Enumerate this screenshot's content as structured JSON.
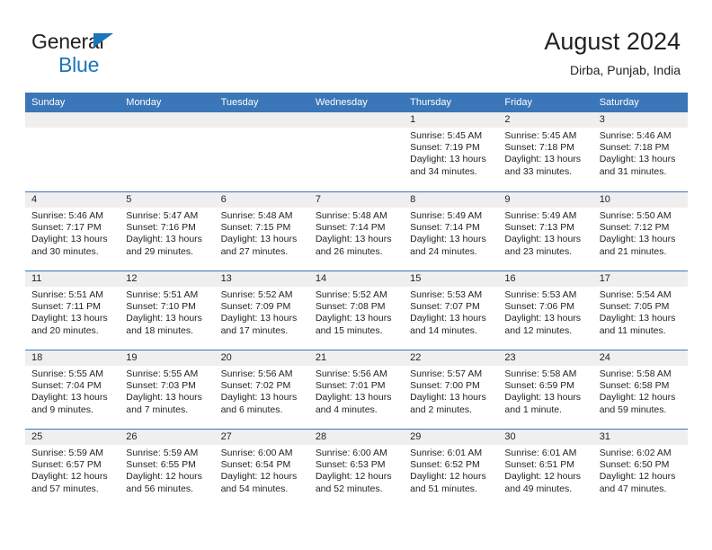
{
  "brand": {
    "line1": "General",
    "line2": "Blue",
    "flag_color": "#1b75bb"
  },
  "header": {
    "title": "August 2024",
    "subtitle": "Dirba, Punjab, India"
  },
  "theme": {
    "header_blue": "#3a76b8",
    "day_band_gray": "#efefef",
    "text_color": "#231f20"
  },
  "calendar": {
    "weekdays": [
      "Sunday",
      "Monday",
      "Tuesday",
      "Wednesday",
      "Thursday",
      "Friday",
      "Saturday"
    ],
    "weeks": [
      [
        {
          "day": "",
          "empty": true
        },
        {
          "day": "",
          "empty": true
        },
        {
          "day": "",
          "empty": true
        },
        {
          "day": "",
          "empty": true
        },
        {
          "day": "1",
          "sunrise": "Sunrise: 5:45 AM",
          "sunset": "Sunset: 7:19 PM",
          "daylight": "Daylight: 13 hours and 34 minutes."
        },
        {
          "day": "2",
          "sunrise": "Sunrise: 5:45 AM",
          "sunset": "Sunset: 7:18 PM",
          "daylight": "Daylight: 13 hours and 33 minutes."
        },
        {
          "day": "3",
          "sunrise": "Sunrise: 5:46 AM",
          "sunset": "Sunset: 7:18 PM",
          "daylight": "Daylight: 13 hours and 31 minutes."
        }
      ],
      [
        {
          "day": "4",
          "sunrise": "Sunrise: 5:46 AM",
          "sunset": "Sunset: 7:17 PM",
          "daylight": "Daylight: 13 hours and 30 minutes."
        },
        {
          "day": "5",
          "sunrise": "Sunrise: 5:47 AM",
          "sunset": "Sunset: 7:16 PM",
          "daylight": "Daylight: 13 hours and 29 minutes."
        },
        {
          "day": "6",
          "sunrise": "Sunrise: 5:48 AM",
          "sunset": "Sunset: 7:15 PM",
          "daylight": "Daylight: 13 hours and 27 minutes."
        },
        {
          "day": "7",
          "sunrise": "Sunrise: 5:48 AM",
          "sunset": "Sunset: 7:14 PM",
          "daylight": "Daylight: 13 hours and 26 minutes."
        },
        {
          "day": "8",
          "sunrise": "Sunrise: 5:49 AM",
          "sunset": "Sunset: 7:14 PM",
          "daylight": "Daylight: 13 hours and 24 minutes."
        },
        {
          "day": "9",
          "sunrise": "Sunrise: 5:49 AM",
          "sunset": "Sunset: 7:13 PM",
          "daylight": "Daylight: 13 hours and 23 minutes."
        },
        {
          "day": "10",
          "sunrise": "Sunrise: 5:50 AM",
          "sunset": "Sunset: 7:12 PM",
          "daylight": "Daylight: 13 hours and 21 minutes."
        }
      ],
      [
        {
          "day": "11",
          "sunrise": "Sunrise: 5:51 AM",
          "sunset": "Sunset: 7:11 PM",
          "daylight": "Daylight: 13 hours and 20 minutes."
        },
        {
          "day": "12",
          "sunrise": "Sunrise: 5:51 AM",
          "sunset": "Sunset: 7:10 PM",
          "daylight": "Daylight: 13 hours and 18 minutes."
        },
        {
          "day": "13",
          "sunrise": "Sunrise: 5:52 AM",
          "sunset": "Sunset: 7:09 PM",
          "daylight": "Daylight: 13 hours and 17 minutes."
        },
        {
          "day": "14",
          "sunrise": "Sunrise: 5:52 AM",
          "sunset": "Sunset: 7:08 PM",
          "daylight": "Daylight: 13 hours and 15 minutes."
        },
        {
          "day": "15",
          "sunrise": "Sunrise: 5:53 AM",
          "sunset": "Sunset: 7:07 PM",
          "daylight": "Daylight: 13 hours and 14 minutes."
        },
        {
          "day": "16",
          "sunrise": "Sunrise: 5:53 AM",
          "sunset": "Sunset: 7:06 PM",
          "daylight": "Daylight: 13 hours and 12 minutes."
        },
        {
          "day": "17",
          "sunrise": "Sunrise: 5:54 AM",
          "sunset": "Sunset: 7:05 PM",
          "daylight": "Daylight: 13 hours and 11 minutes."
        }
      ],
      [
        {
          "day": "18",
          "sunrise": "Sunrise: 5:55 AM",
          "sunset": "Sunset: 7:04 PM",
          "daylight": "Daylight: 13 hours and 9 minutes."
        },
        {
          "day": "19",
          "sunrise": "Sunrise: 5:55 AM",
          "sunset": "Sunset: 7:03 PM",
          "daylight": "Daylight: 13 hours and 7 minutes."
        },
        {
          "day": "20",
          "sunrise": "Sunrise: 5:56 AM",
          "sunset": "Sunset: 7:02 PM",
          "daylight": "Daylight: 13 hours and 6 minutes."
        },
        {
          "day": "21",
          "sunrise": "Sunrise: 5:56 AM",
          "sunset": "Sunset: 7:01 PM",
          "daylight": "Daylight: 13 hours and 4 minutes."
        },
        {
          "day": "22",
          "sunrise": "Sunrise: 5:57 AM",
          "sunset": "Sunset: 7:00 PM",
          "daylight": "Daylight: 13 hours and 2 minutes."
        },
        {
          "day": "23",
          "sunrise": "Sunrise: 5:58 AM",
          "sunset": "Sunset: 6:59 PM",
          "daylight": "Daylight: 13 hours and 1 minute."
        },
        {
          "day": "24",
          "sunrise": "Sunrise: 5:58 AM",
          "sunset": "Sunset: 6:58 PM",
          "daylight": "Daylight: 12 hours and 59 minutes."
        }
      ],
      [
        {
          "day": "25",
          "sunrise": "Sunrise: 5:59 AM",
          "sunset": "Sunset: 6:57 PM",
          "daylight": "Daylight: 12 hours and 57 minutes."
        },
        {
          "day": "26",
          "sunrise": "Sunrise: 5:59 AM",
          "sunset": "Sunset: 6:55 PM",
          "daylight": "Daylight: 12 hours and 56 minutes."
        },
        {
          "day": "27",
          "sunrise": "Sunrise: 6:00 AM",
          "sunset": "Sunset: 6:54 PM",
          "daylight": "Daylight: 12 hours and 54 minutes."
        },
        {
          "day": "28",
          "sunrise": "Sunrise: 6:00 AM",
          "sunset": "Sunset: 6:53 PM",
          "daylight": "Daylight: 12 hours and 52 minutes."
        },
        {
          "day": "29",
          "sunrise": "Sunrise: 6:01 AM",
          "sunset": "Sunset: 6:52 PM",
          "daylight": "Daylight: 12 hours and 51 minutes."
        },
        {
          "day": "30",
          "sunrise": "Sunrise: 6:01 AM",
          "sunset": "Sunset: 6:51 PM",
          "daylight": "Daylight: 12 hours and 49 minutes."
        },
        {
          "day": "31",
          "sunrise": "Sunrise: 6:02 AM",
          "sunset": "Sunset: 6:50 PM",
          "daylight": "Daylight: 12 hours and 47 minutes."
        }
      ]
    ]
  }
}
